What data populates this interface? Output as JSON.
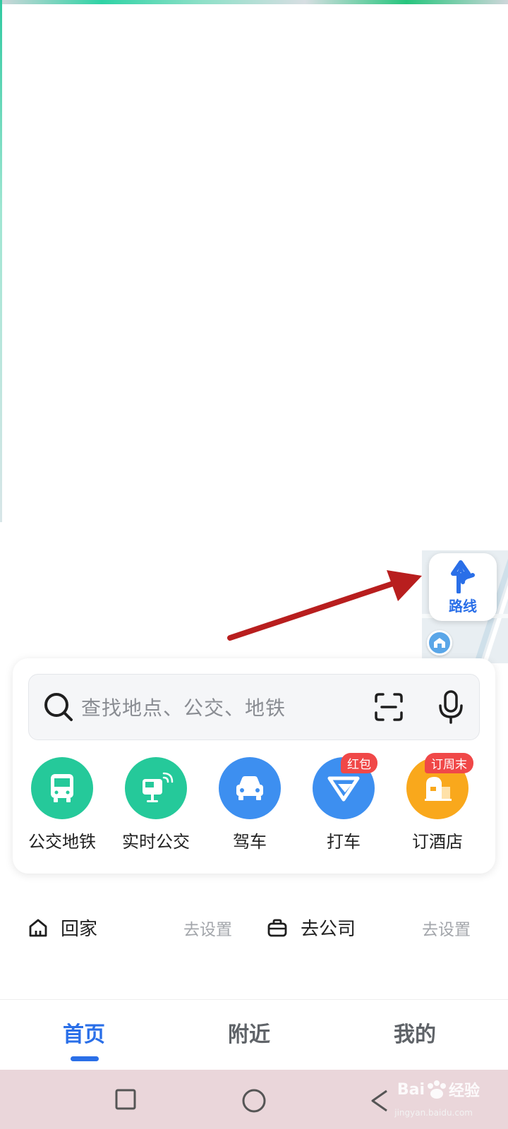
{
  "map": {
    "route_button_label": "路线"
  },
  "search": {
    "placeholder": "查找地点、公交、地铁"
  },
  "shortcuts": [
    {
      "label": "公交地铁",
      "color": "#25c99a",
      "icon": "bus-icon",
      "badge": ""
    },
    {
      "label": "实时公交",
      "color": "#25c99a",
      "icon": "realtime-bus-icon",
      "badge": ""
    },
    {
      "label": "驾车",
      "color": "#3d8ff0",
      "icon": "car-icon",
      "badge": ""
    },
    {
      "label": "打车",
      "color": "#3d8ff0",
      "icon": "taxi-icon",
      "badge": "红包"
    },
    {
      "label": "订酒店",
      "color": "#f9a81c",
      "icon": "hotel-icon",
      "badge": "订周末"
    }
  ],
  "quick_places": {
    "home_label": "回家",
    "home_action": "去设置",
    "work_label": "去公司",
    "work_action": "去设置"
  },
  "bottom_nav": {
    "items": [
      {
        "label": "首页",
        "active": true
      },
      {
        "label": "附近",
        "active": false
      },
      {
        "label": "我的",
        "active": false
      }
    ],
    "accent_color": "#2a6fe8"
  },
  "watermark": {
    "brand": "Bai",
    "brand_suffix": "经验",
    "url": "jingyan.baidu.com"
  }
}
